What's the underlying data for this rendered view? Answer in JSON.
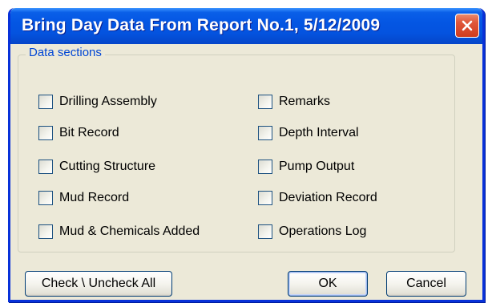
{
  "window": {
    "title": "Bring Day Data From Report No.1, 5/12/2009"
  },
  "group": {
    "label": "Data sections"
  },
  "checkboxes": {
    "left": [
      {
        "label": "Drilling Assembly",
        "checked": false
      },
      {
        "label": "Bit Record",
        "checked": false
      },
      {
        "label": "Cutting Structure",
        "checked": false
      },
      {
        "label": "Mud Record",
        "checked": false
      },
      {
        "label": "Mud & Chemicals Added",
        "checked": false
      }
    ],
    "right": [
      {
        "label": "Remarks",
        "checked": false
      },
      {
        "label": "Depth Interval",
        "checked": false
      },
      {
        "label": "Pump Output",
        "checked": false
      },
      {
        "label": "Deviation Record",
        "checked": false
      },
      {
        "label": "Operations Log",
        "checked": false
      }
    ]
  },
  "buttons": {
    "check_all": "Check \\ Uncheck All",
    "ok": "OK",
    "cancel": "Cancel"
  },
  "colors": {
    "title_bar": "#0456e3",
    "close_button": "#e0573b",
    "dialog_bg": "#ece9d8",
    "group_label": "#0046d5"
  },
  "icons": {
    "close": "close-icon"
  }
}
